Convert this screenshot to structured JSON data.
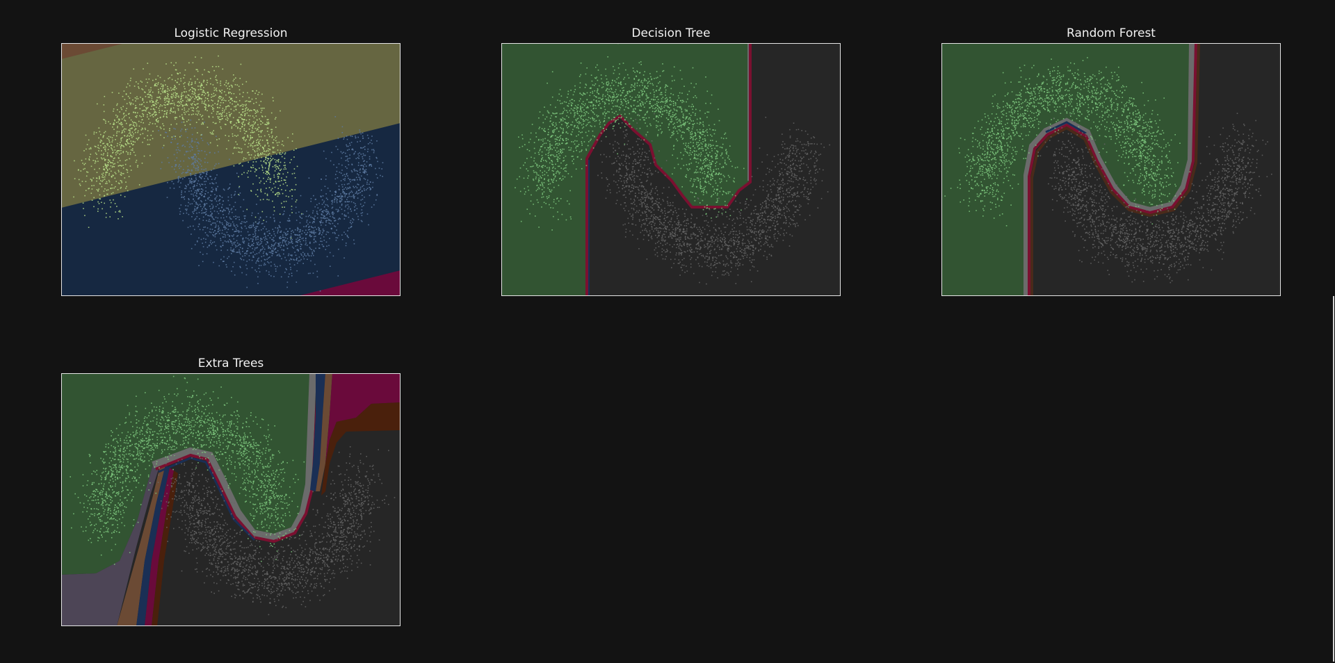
{
  "colors": {
    "background": "#131313",
    "class_a_points": "#7fc97f",
    "class_b_points": "#666666",
    "frame": "#e6e6e6"
  },
  "chart_data": [
    {
      "type": "scatter",
      "title": "Logistic Regression",
      "xlabel": "",
      "ylabel": "",
      "xlim": [
        -1.5,
        2.5
      ],
      "ylim": [
        -1.0,
        1.5
      ],
      "grid": false,
      "overlay": "decision regions (linear boundary)",
      "points_per_class": 5000,
      "series": [
        {
          "class": 0,
          "shape": "upper moon",
          "color": "#b8e08a"
        },
        {
          "class": 1,
          "shape": "lower moon",
          "color": "#5e7ba3"
        }
      ],
      "region_colors": [
        "#6b4a34",
        "#666641",
        "#162841",
        "#6a0a3b"
      ]
    },
    {
      "type": "scatter",
      "title": "Decision Tree",
      "xlabel": "",
      "ylabel": "",
      "xlim": [
        -1.5,
        2.5
      ],
      "ylim": [
        -1.0,
        1.5
      ],
      "grid": false,
      "overlay": "decision regions (axis-aligned)",
      "points_per_class": 5000,
      "series": [
        {
          "class": 0,
          "shape": "upper moon",
          "color": "#7fc97f"
        },
        {
          "class": 1,
          "shape": "lower moon",
          "color": "#666666"
        }
      ],
      "region_colors": [
        "#325432",
        "#262626",
        "#7a1030"
      ]
    },
    {
      "type": "scatter",
      "title": "Random Forest",
      "xlabel": "",
      "ylabel": "",
      "xlim": [
        -1.5,
        2.5
      ],
      "ylim": [
        -1.0,
        1.5
      ],
      "grid": false,
      "overlay": "decision regions (ensemble)",
      "points_per_class": 5000,
      "series": [
        {
          "class": 0,
          "shape": "upper moon",
          "color": "#7fc97f"
        },
        {
          "class": 1,
          "shape": "lower moon",
          "color": "#666666"
        }
      ],
      "region_colors": [
        "#325432",
        "#262626",
        "#7a1030",
        "#1a2f55",
        "#4a2a1a"
      ]
    },
    {
      "type": "scatter",
      "title": "Extra Trees",
      "xlabel": "",
      "ylabel": "",
      "xlim": [
        -1.5,
        2.5
      ],
      "ylim": [
        -1.0,
        1.5
      ],
      "grid": false,
      "overlay": "decision regions (ensemble)",
      "points_per_class": 5000,
      "series": [
        {
          "class": 0,
          "shape": "upper moon",
          "color": "#7fc97f"
        },
        {
          "class": 1,
          "shape": "lower moon",
          "color": "#666666"
        }
      ],
      "region_colors": [
        "#325432",
        "#262626",
        "#4d4556",
        "#6b4a34",
        "#1a2f55",
        "#6a0a3b",
        "#4a200c"
      ]
    }
  ]
}
